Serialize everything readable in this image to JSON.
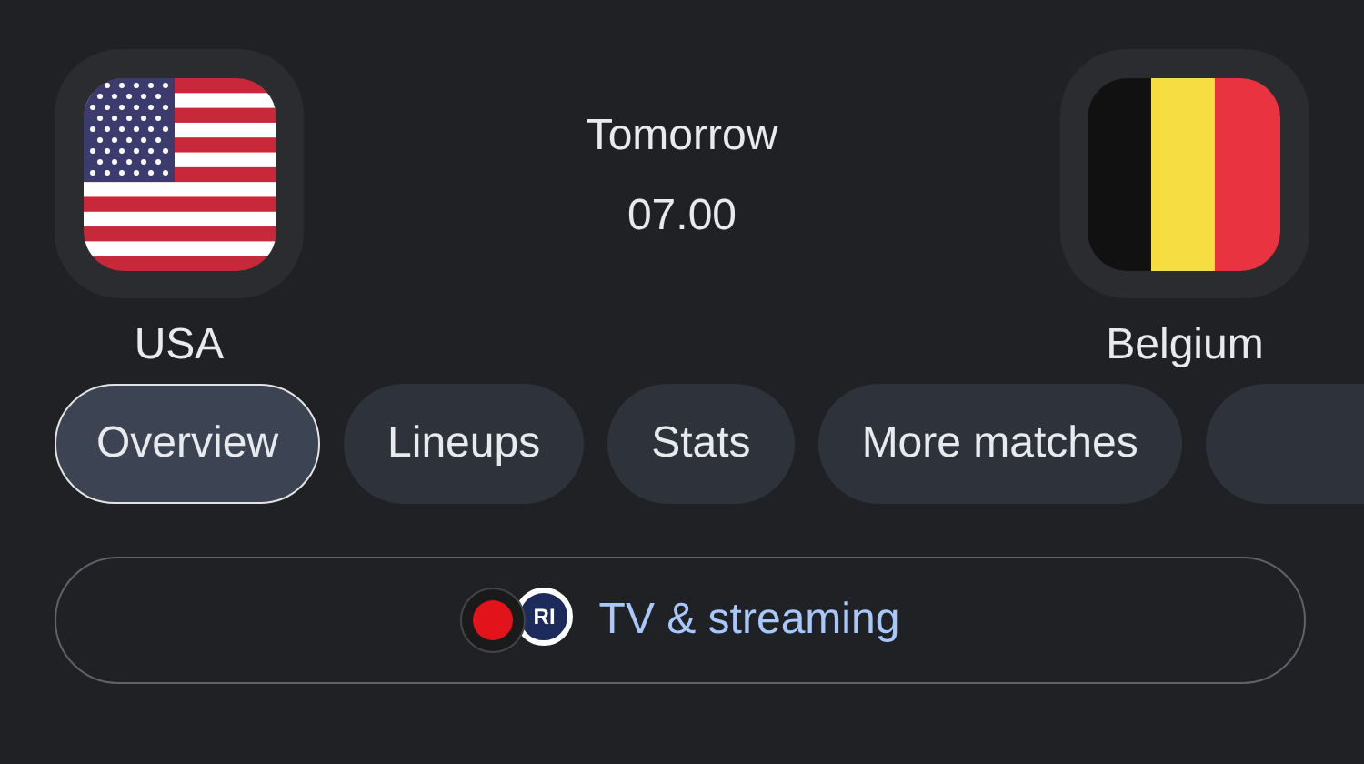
{
  "match": {
    "home": {
      "name": "USA",
      "kind": "usa"
    },
    "away": {
      "name": "Belgium",
      "kind": "belgium"
    },
    "day": "Tomorrow",
    "time": "07.00"
  },
  "tabs": [
    {
      "label": "Overview",
      "selected": true
    },
    {
      "label": "Lineups",
      "selected": false
    },
    {
      "label": "Stats",
      "selected": false
    },
    {
      "label": "More matches",
      "selected": false
    },
    {
      "selected": false
    }
  ],
  "tv_button": {
    "label": "TV & streaming",
    "channels": [
      {
        "kind": "red"
      },
      {
        "kind": "navy",
        "text": "RI"
      }
    ]
  }
}
